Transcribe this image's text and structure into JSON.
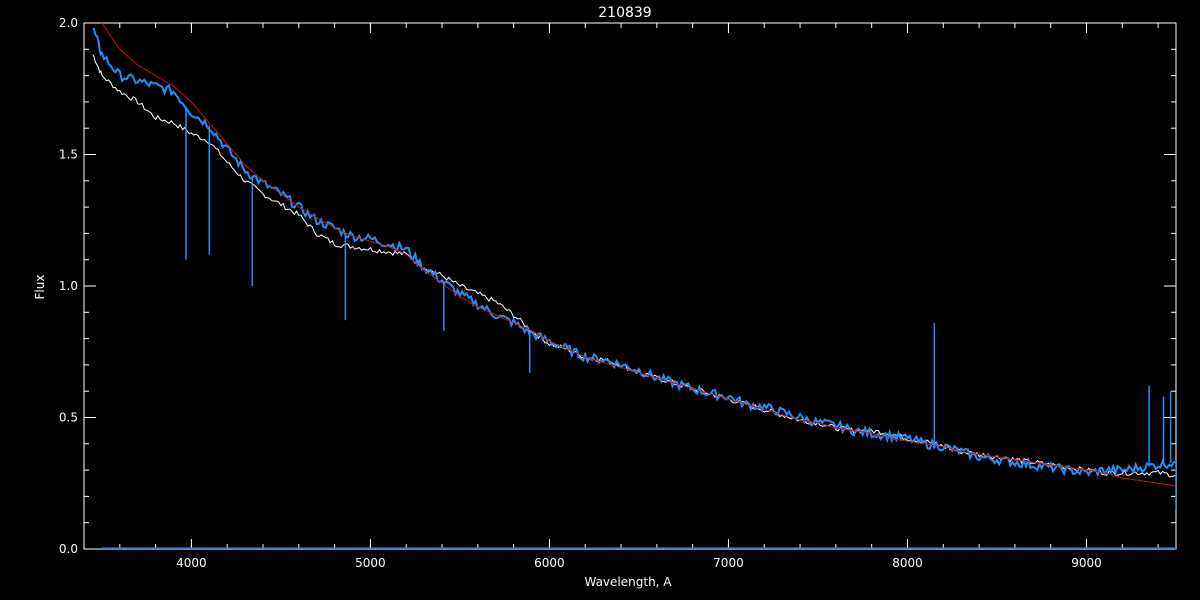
{
  "chart_data": {
    "type": "line",
    "title": "210839",
    "xlabel": "Wavelength, A",
    "ylabel": "Flux",
    "xlim": [
      3400,
      9500
    ],
    "ylim": [
      0.0,
      2.0
    ],
    "x_ticks": [
      4000,
      5000,
      6000,
      7000,
      8000,
      9000
    ],
    "x_tick_labels": [
      "4000",
      "5000",
      "6000",
      "7000",
      "8000",
      "9000"
    ],
    "x_minor_step": 200,
    "y_ticks": [
      0.0,
      0.5,
      1.0,
      1.5,
      2.0
    ],
    "y_tick_labels": [
      "0.0",
      "0.5",
      "1.0",
      "1.5",
      "2.0"
    ],
    "y_minor_step": 0.1,
    "grid": false,
    "background": "#000000",
    "axis_color": "#ffffff",
    "series": [
      {
        "color": "#ffffff",
        "x": [
          3450,
          3500,
          3600,
          3700,
          3800,
          3900,
          4000,
          4100,
          4200,
          4300,
          4400,
          4500,
          4600,
          4700,
          4800,
          4900,
          5000,
          5100,
          5200,
          5300,
          5400,
          5500,
          5600,
          5700,
          5800,
          5900,
          6000,
          6100,
          6200,
          6300,
          6400,
          6500,
          6600,
          6700,
          6800,
          6900,
          7000,
          7100,
          7200,
          7300,
          7400,
          7500,
          7600,
          7700,
          7800,
          7900,
          8000,
          8100,
          8200,
          8300,
          8400,
          8500,
          8600,
          8700,
          8800,
          8900,
          9000,
          9100,
          9200,
          9300,
          9400,
          9500
        ],
        "y": [
          1.88,
          1.8,
          1.74,
          1.7,
          1.64,
          1.62,
          1.58,
          1.55,
          1.47,
          1.4,
          1.35,
          1.31,
          1.27,
          1.2,
          1.16,
          1.15,
          1.14,
          1.13,
          1.12,
          1.07,
          1.04,
          1.0,
          0.97,
          0.94,
          0.89,
          0.83,
          0.78,
          0.76,
          0.73,
          0.72,
          0.7,
          0.67,
          0.65,
          0.63,
          0.61,
          0.59,
          0.57,
          0.55,
          0.53,
          0.51,
          0.49,
          0.48,
          0.46,
          0.45,
          0.45,
          0.44,
          0.42,
          0.41,
          0.39,
          0.37,
          0.36,
          0.35,
          0.34,
          0.33,
          0.32,
          0.31,
          0.3,
          0.29,
          0.29,
          0.29,
          0.29,
          0.28
        ]
      },
      {
        "color": "#1e90ff",
        "x": [
          3450,
          3500,
          3600,
          3700,
          3800,
          3900,
          4000,
          4100,
          4200,
          4300,
          4400,
          4500,
          4600,
          4700,
          4800,
          4900,
          5000,
          5100,
          5200,
          5300,
          5400,
          5500,
          5600,
          5700,
          5800,
          5900,
          6000,
          6100,
          6200,
          6300,
          6400,
          6500,
          6600,
          6700,
          6800,
          6900,
          7000,
          7100,
          7200,
          7300,
          7400,
          7500,
          7600,
          7700,
          7800,
          7900,
          8000,
          8100,
          8200,
          8300,
          8400,
          8500,
          8600,
          8700,
          8800,
          8900,
          9000,
          9100,
          9200,
          9300,
          9400,
          9500
        ],
        "y": [
          1.98,
          1.88,
          1.8,
          1.78,
          1.76,
          1.74,
          1.66,
          1.61,
          1.52,
          1.44,
          1.39,
          1.35,
          1.3,
          1.25,
          1.22,
          1.19,
          1.18,
          1.16,
          1.14,
          1.07,
          1.02,
          0.97,
          0.93,
          0.89,
          0.86,
          0.82,
          0.79,
          0.76,
          0.73,
          0.72,
          0.7,
          0.68,
          0.65,
          0.63,
          0.61,
          0.59,
          0.58,
          0.55,
          0.54,
          0.52,
          0.5,
          0.48,
          0.47,
          0.45,
          0.44,
          0.43,
          0.42,
          0.4,
          0.39,
          0.37,
          0.35,
          0.34,
          0.33,
          0.32,
          0.31,
          0.3,
          0.29,
          0.3,
          0.3,
          0.31,
          0.32,
          0.33
        ]
      },
      {
        "color": "#d01010",
        "x": [
          3450,
          3500,
          3600,
          3700,
          3800,
          3900,
          4000,
          4100,
          4200,
          4300,
          4400,
          4500,
          4600,
          4700,
          4800,
          4900,
          5000,
          5100,
          5200,
          5300,
          5400,
          5500,
          5600,
          5700,
          5800,
          5900,
          6000,
          6100,
          6200,
          6300,
          6400,
          6500,
          6600,
          6700,
          6800,
          6900,
          7000,
          7100,
          7200,
          7300,
          7400,
          7500,
          7600,
          7700,
          7800,
          7900,
          8000,
          8100,
          8200,
          8300,
          8400,
          8500,
          8600,
          8700,
          8800,
          8900,
          9000,
          9100,
          9200,
          9300,
          9400,
          9500
        ],
        "y": [
          2.05,
          2.0,
          1.9,
          1.84,
          1.8,
          1.76,
          1.7,
          1.62,
          1.54,
          1.46,
          1.4,
          1.35,
          1.3,
          1.26,
          1.22,
          1.19,
          1.17,
          1.15,
          1.12,
          1.06,
          1.01,
          0.96,
          0.92,
          0.89,
          0.86,
          0.83,
          0.79,
          0.76,
          0.73,
          0.71,
          0.69,
          0.67,
          0.65,
          0.63,
          0.61,
          0.59,
          0.57,
          0.55,
          0.53,
          0.51,
          0.49,
          0.48,
          0.46,
          0.45,
          0.44,
          0.42,
          0.41,
          0.4,
          0.39,
          0.37,
          0.36,
          0.35,
          0.34,
          0.33,
          0.32,
          0.31,
          0.3,
          0.29,
          0.27,
          0.26,
          0.25,
          0.24
        ]
      }
    ],
    "emission_spikes": [
      {
        "x": 8150,
        "y_top": 0.86,
        "color": "#1e90ff"
      },
      {
        "x": 9350,
        "y_top": 0.62,
        "color": "#1e90ff"
      },
      {
        "x": 9430,
        "y_top": 0.58,
        "color": "#1e90ff"
      },
      {
        "x": 9470,
        "y_top": 0.6,
        "color": "#1e90ff"
      }
    ],
    "absorption_dips": [
      {
        "x": 3970,
        "y_bottom": 1.1,
        "color": "#1e90ff"
      },
      {
        "x": 4100,
        "y_bottom": 1.12,
        "color": "#1e90ff"
      },
      {
        "x": 4340,
        "y_bottom": 1.0,
        "color": "#1e90ff"
      },
      {
        "x": 4860,
        "y_bottom": 0.87,
        "color": "#1e90ff"
      },
      {
        "x": 5410,
        "y_bottom": 0.83,
        "color": "#1e90ff"
      },
      {
        "x": 5890,
        "y_bottom": 0.67,
        "color": "#1e90ff"
      },
      {
        "x": 9500,
        "y_bottom": 0.15,
        "color": "#1e90ff"
      }
    ]
  }
}
